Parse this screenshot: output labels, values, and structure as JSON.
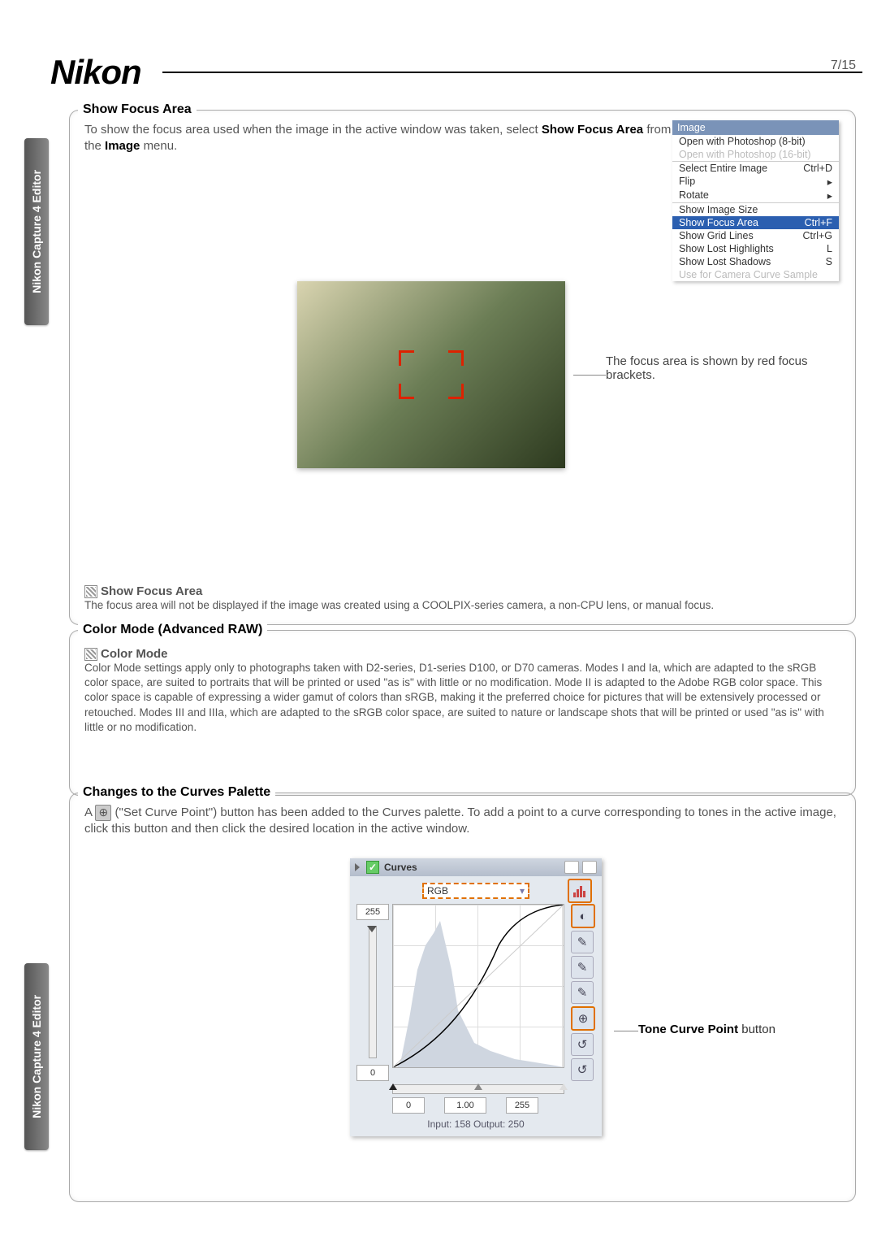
{
  "logo": "Nikon",
  "pagenum": "7/15",
  "sidetab": "Nikon Capture 4 Editor",
  "showFocus": {
    "title": "Show Focus Area",
    "body_pre": "To show the focus area used when the image in the active window was taken, select ",
    "body_bold1": "Show Focus Area",
    "body_mid": " from the ",
    "body_bold2": "Image",
    "body_post": " menu.",
    "caption": "The focus area is shown by red focus brackets.",
    "noteTitle": "Show Focus Area",
    "noteBody": "The focus area will not be displayed if the image was created using a COOLPIX-series camera, a non-CPU lens, or manual focus."
  },
  "menu": {
    "head": "Image",
    "items": [
      {
        "label": "Open with Photoshop (8-bit)",
        "accel": "",
        "cls": ""
      },
      {
        "label": "Open with Photoshop (16-bit)",
        "accel": "",
        "cls": "dis",
        "sec": true
      },
      {
        "label": "Select Entire Image",
        "accel": "Ctrl+D",
        "cls": ""
      },
      {
        "label": "Flip",
        "accel": "▸",
        "cls": ""
      },
      {
        "label": "Rotate",
        "accel": "▸",
        "cls": "",
        "sec": true
      },
      {
        "label": "Show Image Size",
        "accel": "",
        "cls": ""
      },
      {
        "label": "Show Focus Area",
        "accel": "Ctrl+F",
        "cls": "sel"
      },
      {
        "label": "Show Grid Lines",
        "accel": "Ctrl+G",
        "cls": ""
      },
      {
        "label": "Show Lost Highlights",
        "accel": "L",
        "cls": ""
      },
      {
        "label": "Show Lost Shadows",
        "accel": "S",
        "cls": ""
      },
      {
        "label": "Use for Camera Curve Sample",
        "accel": "",
        "cls": "dis"
      }
    ]
  },
  "color": {
    "title": "Color Mode (Advanced RAW)",
    "noteTitle": "Color Mode",
    "noteBody": "Color Mode settings apply only to photographs taken with D2-series, D1-series D100, or D70 cameras.  Modes I and Ia, which are adapted to the sRGB color space, are suited to portraits that will be printed or used \"as is\" with little or no modification.  Mode II is adapted to the Adobe RGB color space.  This color space is capable of expressing a wider gamut of colors than sRGB, making it the preferred choice for pictures that will be extensively processed or retouched.  Modes III and IIIa, which are adapted to the sRGB color space, are suited to nature or landscape shots that will be printed or used \"as is\" with little or no modification."
  },
  "curves": {
    "title": "Changes to the Curves Palette",
    "body_pre": "A ",
    "body_mid": " (\"Set Curve Point\") button has been added to the Curves palette.  To add a point to a curve corresponding to tones in the active image, click this button and then click the desired location in the active window.",
    "winTitle": "Curves",
    "channel": "RGB",
    "yTop": "255",
    "yBot": "0",
    "xLeft": "0",
    "gamma": "1.00",
    "xRight": "255",
    "io": "Input: 158   Output: 250",
    "tcap_pre": "Tone Curve Point",
    "tcap_post": " button"
  }
}
